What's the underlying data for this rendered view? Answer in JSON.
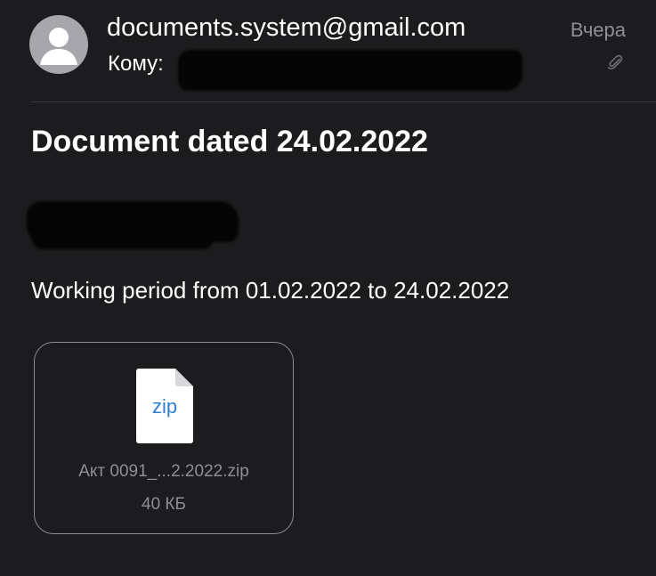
{
  "header": {
    "sender": "documents.system@gmail.com",
    "to_label": "Кому:",
    "date": "Вчера",
    "avatar_icon": "person-icon",
    "attachment_indicator_icon": "paperclip-icon"
  },
  "message": {
    "subject": "Document dated 24.02.2022",
    "body": "Working period from 01.02.2022 to 24.02.2022"
  },
  "attachment": {
    "extension": "zip",
    "file_name": "Акт 0091_...2.2022.zip",
    "file_size": "40 КБ",
    "icon": "zip-file-icon"
  },
  "colors": {
    "background": "#1c1c1e",
    "secondary_text": "#8e8e93",
    "zip_label": "#2f7fd6"
  }
}
